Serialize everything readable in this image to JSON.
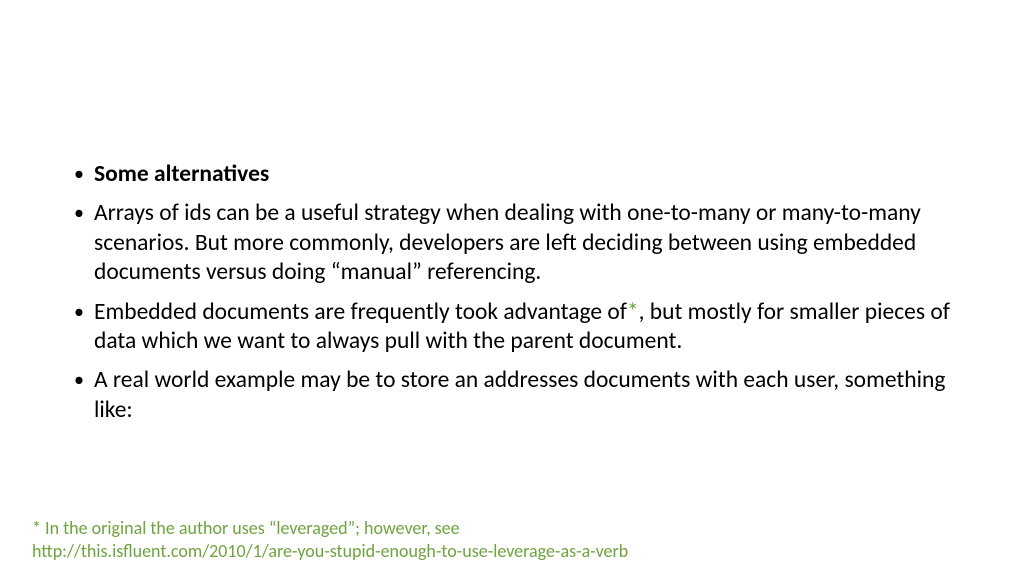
{
  "bullets": {
    "b1": "Some alternatives",
    "b2": "Arrays of ids can be a useful strategy when dealing with one-to-many or many-to-many scenarios. But more commonly, developers are left deciding between using embedded documents versus doing “manual” referencing.",
    "b3_pre": "Embedded documents are frequently took advantage of",
    "b3_star": "*",
    "b3_post": ", but mostly for smaller pieces of data which we want to always pull with the parent document.",
    "b4": "A real world example may be to store an addresses documents with each user, something like:"
  },
  "footnote": {
    "line1": "* In the original the author uses “leveraged”; however, see",
    "line2": "http://this.isfluent.com/2010/1/are-you-stupid-enough-to-use-leverage-as-a-verb"
  }
}
